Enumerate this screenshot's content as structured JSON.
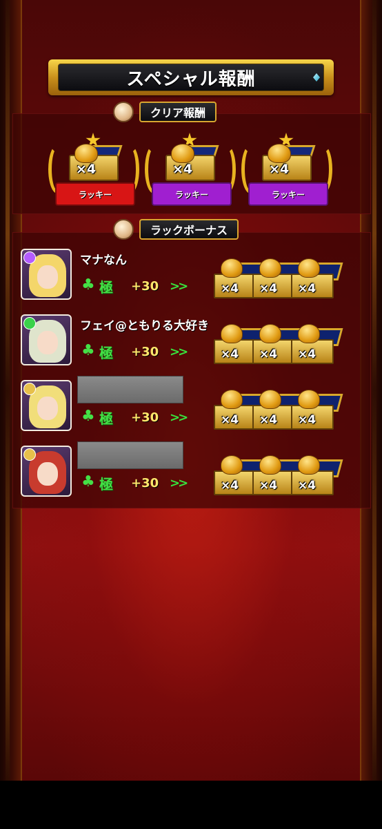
{
  "title": "スペシャル報酬",
  "clear_reward": {
    "label": "クリア報酬",
    "items": [
      {
        "count": "×4",
        "tag": "ラッキー",
        "ribbon_color": "#d81515"
      },
      {
        "count": "×4",
        "tag": "ラッキー",
        "ribbon_color": "#a01fd0"
      },
      {
        "count": "×4",
        "tag": "ラッキー",
        "ribbon_color": "#a01fd0"
      }
    ]
  },
  "luck_bonus": {
    "label": "ラックボーナス",
    "players": [
      {
        "name": "マナなん",
        "luck": "極",
        "bonus": "+30",
        "arrow": ">>",
        "chests": [
          "×4",
          "×4",
          "×4"
        ],
        "element_color": "#b45cff",
        "hair_color": "#f4d66a"
      },
      {
        "name": "フェイ@ともりる大好き",
        "luck": "極",
        "bonus": "+30",
        "arrow": ">>",
        "chests": [
          "×4",
          "×4",
          "×4"
        ],
        "element_color": "#3ad14a",
        "hair_color": "#dfe4cc"
      },
      {
        "name": "",
        "luck": "極",
        "bonus": "+30",
        "arrow": ">>",
        "chests": [
          "×4",
          "×4",
          "×4"
        ],
        "element_color": "#e7c04a",
        "hair_color": "#f1de7a"
      },
      {
        "name": "",
        "luck": "極",
        "bonus": "+30",
        "arrow": ">>",
        "chests": [
          "×4",
          "×4",
          "×4"
        ],
        "element_color": "#e7c04a",
        "hair_color": "#c83b2e"
      }
    ]
  }
}
